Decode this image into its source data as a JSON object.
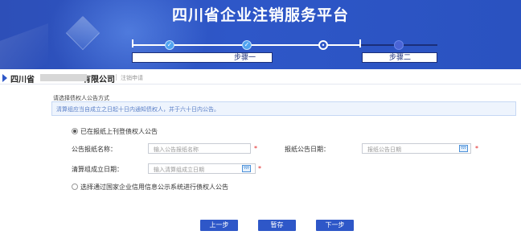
{
  "header": {
    "title": "四川省企业注销服务平台"
  },
  "steps": {
    "items": [
      {
        "label": "步骤一",
        "state": "current"
      },
      {
        "label": "步骤二",
        "state": "pending"
      }
    ],
    "check_glyph": "✓",
    "current_glyph": "•"
  },
  "company": {
    "name_prefix": "四川省",
    "name_suffix": "有限公司",
    "breadcrumb": "注销申请"
  },
  "form": {
    "section_label": "请选择债权人公告方式",
    "tip": "清算组应当自成立之日起十日内通知债权人，并于六十日内公告。",
    "options": [
      {
        "label": "已在报纸上刊登债权人公告",
        "selected": true
      },
      {
        "label": "选择通过国家企业信用信息公示系统进行债权人公告",
        "selected": false
      }
    ],
    "fields": {
      "newspaper_name": {
        "label": "公告报纸名称：",
        "placeholder": "输入公告报纸名称",
        "required_mark": "*"
      },
      "newspaper_date": {
        "label": "报纸公告日期：",
        "placeholder": "报纸公告日期",
        "required_mark": "*"
      },
      "liquidation_date": {
        "label": "清算组成立日期：",
        "placeholder": "输入清算组成立日期",
        "required_mark": "*"
      }
    }
  },
  "actions": {
    "prev": "上一步",
    "save": "暂存",
    "next": "下一步"
  },
  "colors": {
    "brand": "#2e57c8",
    "required": "#e02020",
    "tip_text": "#5a7fc7"
  },
  "icons": [
    "calendar-icon",
    "check-icon",
    "arrow-marker-icon"
  ]
}
